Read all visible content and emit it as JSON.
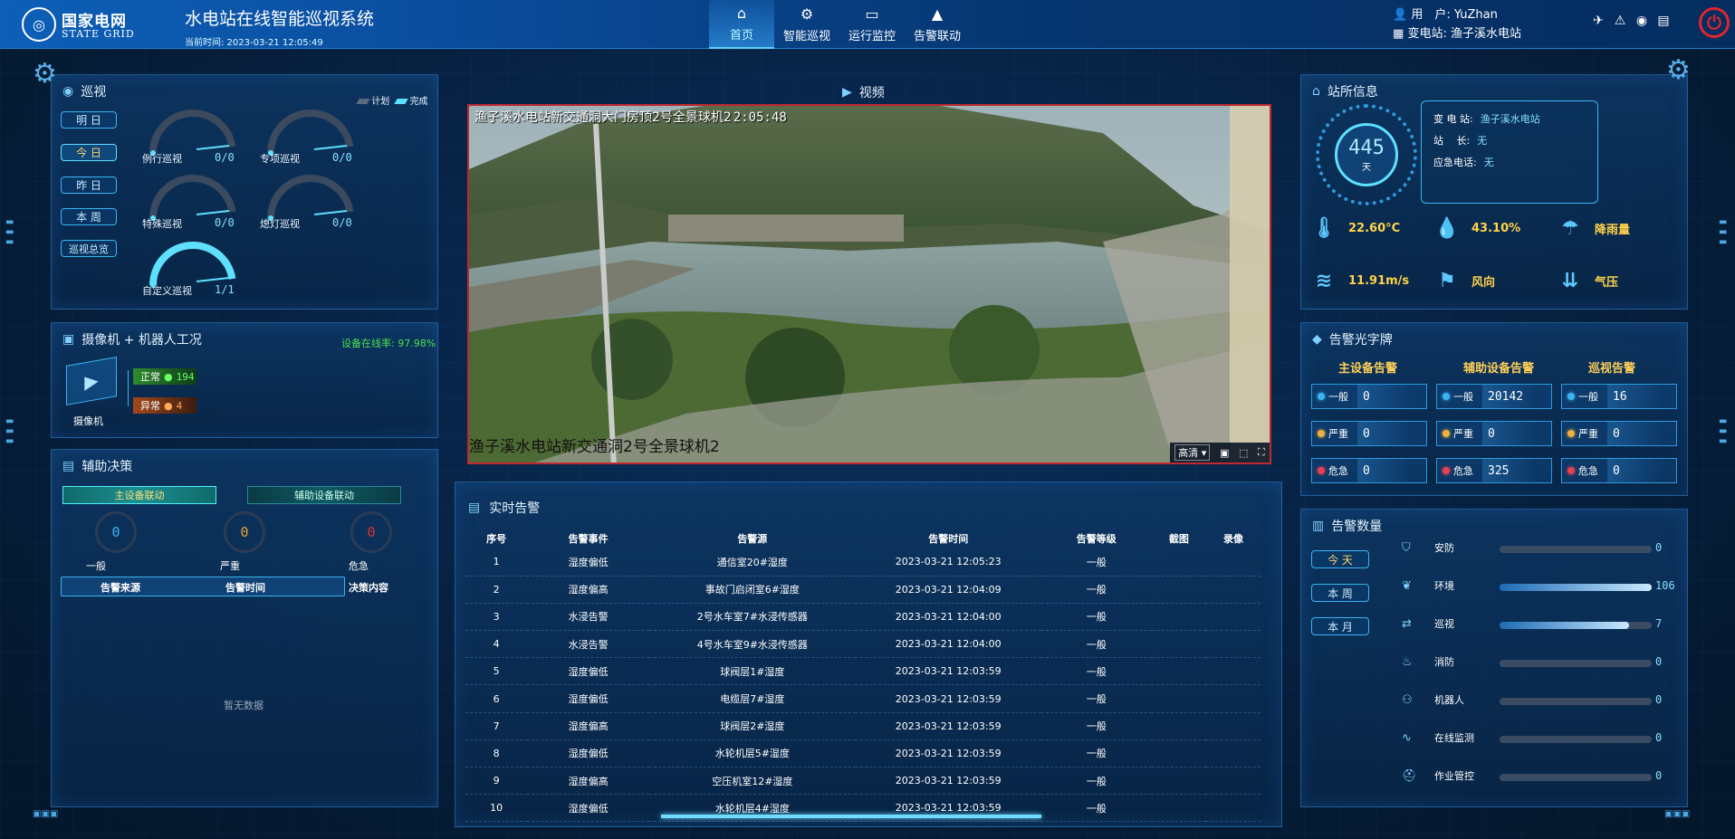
{
  "header": {
    "logo_cn": "国家电网",
    "logo_en": "STATE GRID",
    "title": "水电站在线智能巡视系统",
    "time_label": "当前时间: 2023-03-21 12:05:49",
    "nav": [
      {
        "label": "首页",
        "icon": "home-icon",
        "active": true
      },
      {
        "label": "智能巡视",
        "icon": "gear-icon",
        "active": false
      },
      {
        "label": "运行监控",
        "icon": "monitor-icon",
        "active": false
      },
      {
        "label": "告警联动",
        "icon": "warning-icon",
        "active": false
      }
    ],
    "user_label": "用　户: YuZhan",
    "station_label": "变电站: 渔子溪水电站"
  },
  "patrol": {
    "title": "巡视",
    "legend_plan": "计划",
    "legend_done": "完成",
    "periods": [
      "明 日",
      "今 日",
      "昨 日",
      "本 周",
      "巡视总览"
    ],
    "gauges": [
      {
        "label": "例行巡视",
        "value": "0/0",
        "fill": 0.0
      },
      {
        "label": "专项巡视",
        "value": "0/0",
        "fill": 0.0
      },
      {
        "label": "特殊巡视",
        "value": "0/0",
        "fill": 0.0
      },
      {
        "label": "熄灯巡视",
        "value": "0/0",
        "fill": 0.0
      },
      {
        "label": "自定义巡视",
        "value": "1/1",
        "fill": 1.0
      }
    ]
  },
  "camera": {
    "title": "摄像机 + 机器人工况",
    "online_rate": "设备在线率: 97.98%",
    "device_label": "摄像机",
    "normal_label": "正常",
    "normal_count": "194",
    "abnormal_label": "异常",
    "abnormal_count": "4"
  },
  "decision": {
    "title": "辅助决策",
    "tab_main": "主设备联动",
    "tab_aux": "辅助设备联动",
    "stats": [
      {
        "label": "一般",
        "value": "0",
        "color": "#3ab5f0"
      },
      {
        "label": "严重",
        "value": "0",
        "color": "#f0a030"
      },
      {
        "label": "危急",
        "value": "0",
        "color": "#e03030"
      }
    ],
    "cols": [
      "告警来源",
      "告警时间",
      "决策内容"
    ],
    "empty": "暂无数据"
  },
  "video": {
    "title": "视频",
    "osd_top": "渔子溪水电站新交通洞大门房顶2号全景球机2",
    "osd_time": "2:05:48",
    "osd_bottom": "渔子溪水电站新交通洞2号全景球机2",
    "quality": "高清"
  },
  "alarms": {
    "title": "实时告警",
    "headers": [
      "序号",
      "告警事件",
      "告警源",
      "告警时间",
      "告警等级",
      "截图",
      "录像"
    ],
    "rows": [
      [
        "1",
        "湿度偏低",
        "通信室20#湿度",
        "2023-03-21 12:05:23",
        "一般",
        "",
        ""
      ],
      [
        "2",
        "湿度偏高",
        "事故门启闭室6#湿度",
        "2023-03-21 12:04:09",
        "一般",
        "",
        ""
      ],
      [
        "3",
        "水浸告警",
        "2号水车室7#水浸传感器",
        "2023-03-21 12:04:00",
        "一般",
        "",
        ""
      ],
      [
        "4",
        "水浸告警",
        "4号水车室9#水浸传感器",
        "2023-03-21 12:04:00",
        "一般",
        "",
        ""
      ],
      [
        "5",
        "湿度偏低",
        "球阀层1#湿度",
        "2023-03-21 12:03:59",
        "一般",
        "",
        ""
      ],
      [
        "6",
        "湿度偏低",
        "电缆层7#湿度",
        "2023-03-21 12:03:59",
        "一般",
        "",
        ""
      ],
      [
        "7",
        "湿度偏高",
        "球阀层2#湿度",
        "2023-03-21 12:03:59",
        "一般",
        "",
        ""
      ],
      [
        "8",
        "湿度偏低",
        "水轮机层5#湿度",
        "2023-03-21 12:03:59",
        "一般",
        "",
        ""
      ],
      [
        "9",
        "湿度偏高",
        "空压机室12#湿度",
        "2023-03-21 12:03:59",
        "一般",
        "",
        ""
      ],
      [
        "10",
        "湿度偏低",
        "水轮机层4#湿度",
        "2023-03-21 12:03:59",
        "一般",
        "",
        ""
      ]
    ]
  },
  "station": {
    "title": "站所信息",
    "days": "445",
    "days_unit": "天",
    "name_label": "变 电 站:",
    "name": "渔子溪水电站",
    "chief_label": "站　 长:",
    "chief": "无",
    "phone_label": "应急电话:",
    "phone": "无",
    "env": [
      {
        "icon": "thermometer-icon",
        "label": "22.60°C"
      },
      {
        "icon": "humidity-icon",
        "label": "43.10%"
      },
      {
        "icon": "rain-icon",
        "label": "降雨量"
      },
      {
        "icon": "wind-speed-icon",
        "label": "11.91m/s"
      },
      {
        "icon": "wind-direction-icon",
        "label": "风向"
      },
      {
        "icon": "pressure-icon",
        "label": "气压"
      }
    ]
  },
  "alarm_board": {
    "title": "告警光字牌",
    "columns": [
      {
        "head": "主设备告警",
        "cells": [
          {
            "level": "一般",
            "value": "0"
          },
          {
            "level": "严重",
            "value": "0"
          },
          {
            "level": "危急",
            "value": "0"
          }
        ]
      },
      {
        "head": "辅助设备告警",
        "cells": [
          {
            "level": "一般",
            "value": "20142"
          },
          {
            "level": "严重",
            "value": "0"
          },
          {
            "level": "危急",
            "value": "325"
          }
        ]
      },
      {
        "head": "巡视告警",
        "cells": [
          {
            "level": "一般",
            "value": "16"
          },
          {
            "level": "严重",
            "value": "0"
          },
          {
            "level": "危急",
            "value": "0"
          }
        ]
      }
    ],
    "level_colors": {
      "一般": "#3ab5f0",
      "严重": "#f0b040",
      "危急": "#e84050"
    }
  },
  "alarm_count": {
    "title": "告警数量",
    "periods": [
      "今 天",
      "本 周",
      "本 月"
    ],
    "items": [
      {
        "label": "安防",
        "icon": "shield-icon",
        "value": "0",
        "fill": 0.0
      },
      {
        "label": "环境",
        "icon": "leaf-icon",
        "value": "106",
        "fill": 1.0
      },
      {
        "label": "巡视",
        "icon": "route-icon",
        "value": "7",
        "fill": 0.85
      },
      {
        "label": "消防",
        "icon": "fire-extinguisher-icon",
        "value": "0",
        "fill": 0.0
      },
      {
        "label": "机器人",
        "icon": "robot-icon",
        "value": "0",
        "fill": 0.0
      },
      {
        "label": "在线监测",
        "icon": "pulse-icon",
        "value": "0",
        "fill": 0.0
      },
      {
        "label": "作业管控",
        "icon": "helmet-icon",
        "value": "0",
        "fill": 0.0
      }
    ]
  }
}
